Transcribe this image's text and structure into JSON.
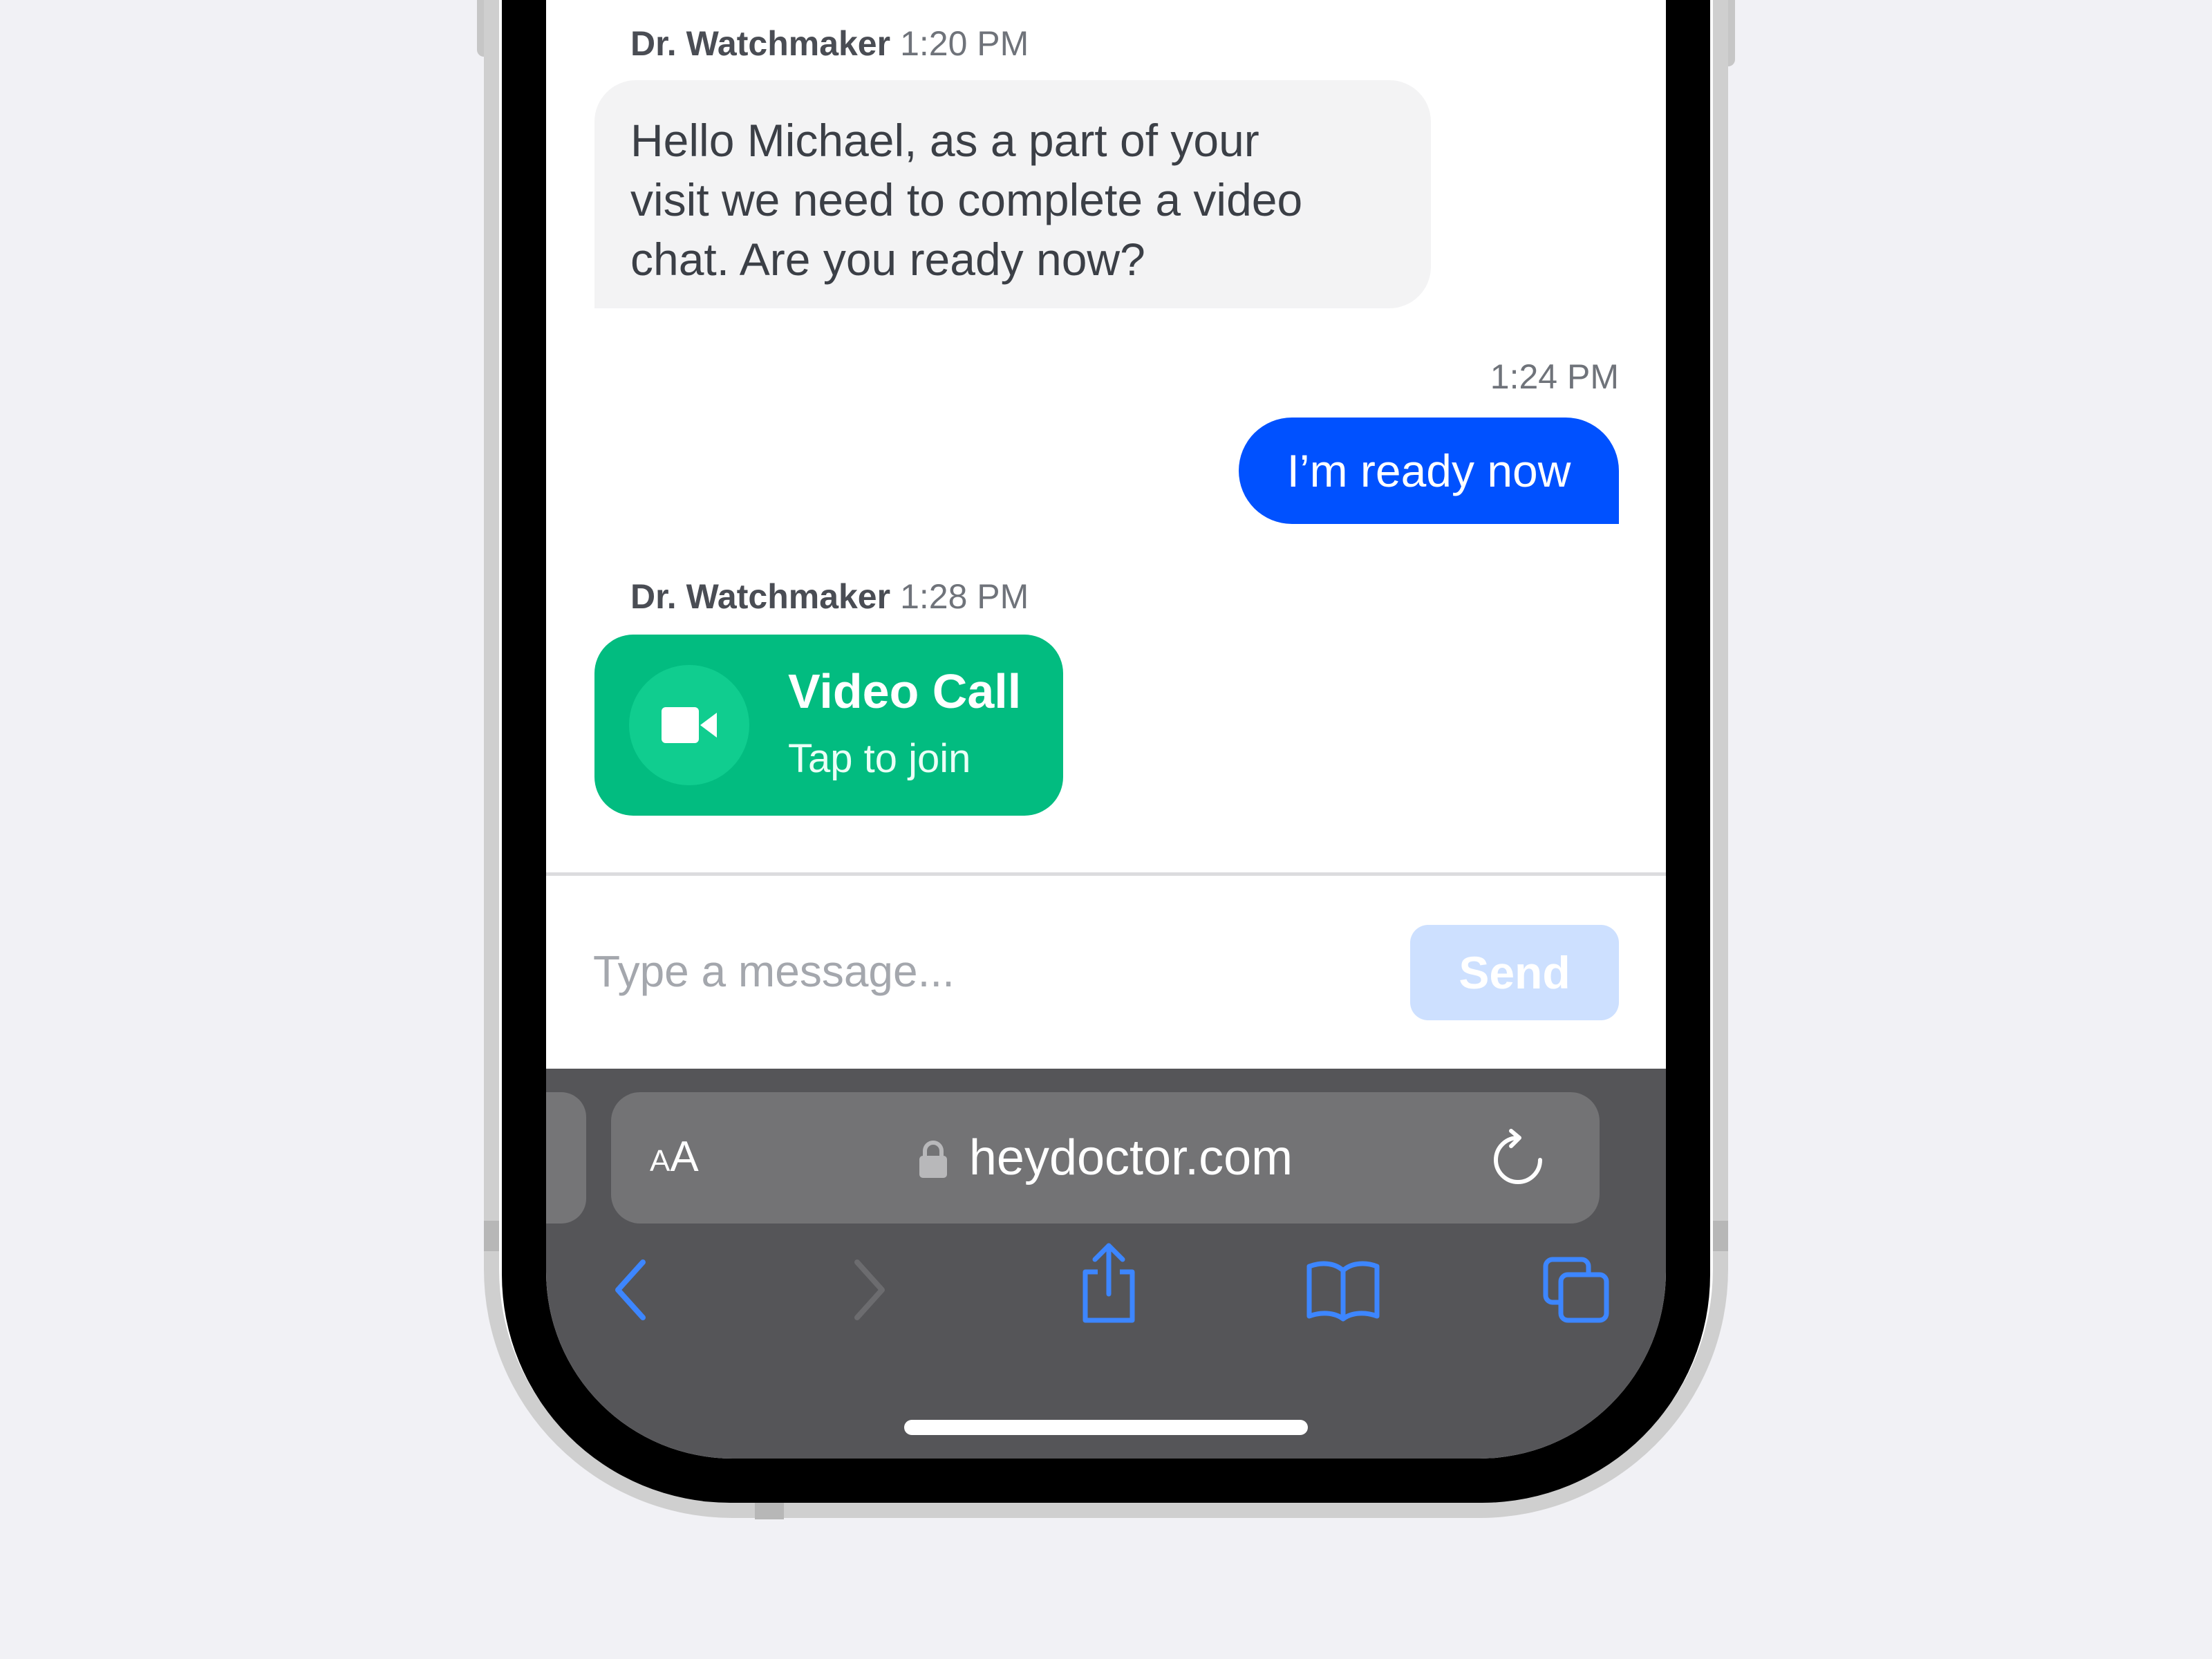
{
  "chat": {
    "messages": [
      {
        "sender": "Dr. Watchmaker",
        "time": "1:20 PM",
        "text": "Hello Michael, as a part of your\nvisit we need to complete a video\nchat. Are you ready now?"
      },
      {
        "time": "1:24 PM",
        "text": "I’m ready now"
      },
      {
        "sender": "Dr. Watchmaker",
        "time": "1:28 PM"
      }
    ],
    "video_call": {
      "title": "Video Call",
      "subtitle": "Tap to join",
      "icon": "video-camera-icon"
    },
    "composer": {
      "placeholder": "Type a message...",
      "send_label": "Send"
    }
  },
  "browser": {
    "text_size_button": {
      "small": "A",
      "large": "A"
    },
    "url": "heydoctor.com",
    "icons": [
      "lock-icon",
      "reload-icon",
      "back-icon",
      "forward-icon",
      "share-icon",
      "bookmarks-icon",
      "tabs-icon"
    ]
  },
  "colors": {
    "incoming_bubble": "#f3f3f4",
    "outgoing_bubble": "#0051ff",
    "video_card": "#02bc80",
    "send_button_disabled": "#cde0ff",
    "safari_toolbar": "#555558",
    "toolbar_icon_active": "#3d86ff"
  }
}
